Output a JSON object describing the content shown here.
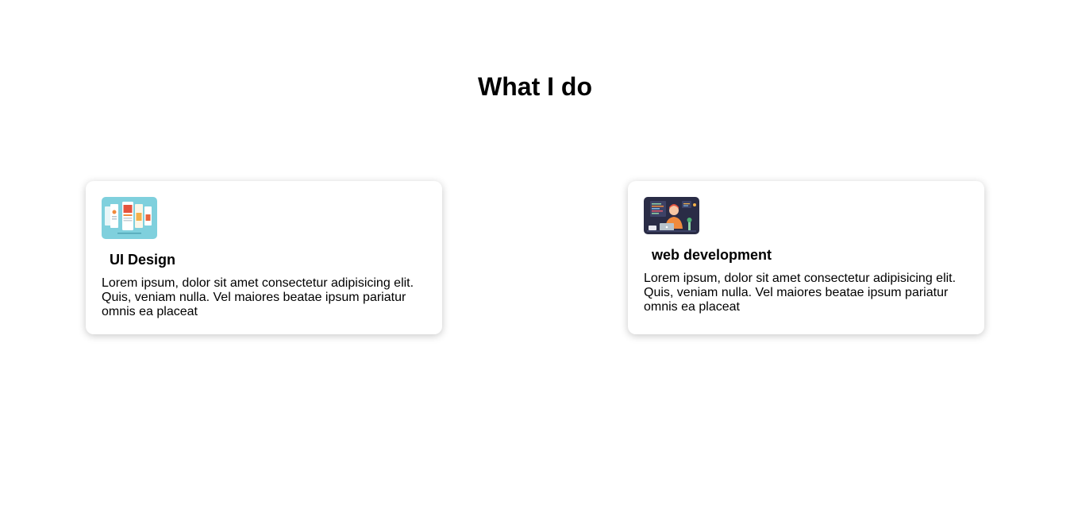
{
  "section": {
    "title": "What I do"
  },
  "cards": [
    {
      "icon": "mobile-ui-mockups-image",
      "title": "UI Design",
      "description": "Lorem ipsum, dolor sit amet consectetur adipisicing elit. Quis, veniam nulla. Vel maiores beatae ipsum pariatur omnis ea placeat"
    },
    {
      "icon": "developer-at-desk-image",
      "title": "web development",
      "description": "Lorem ipsum, dolor sit amet consectetur adipisicing elit. Quis, veniam nulla. Vel maiores beatae ipsum pariatur omnis ea placeat"
    }
  ],
  "colors": {
    "ui_thumb_bg": "#7fd0dd",
    "dev_thumb_bg": "#2a2c46",
    "accent_orange": "#f08a3c"
  }
}
